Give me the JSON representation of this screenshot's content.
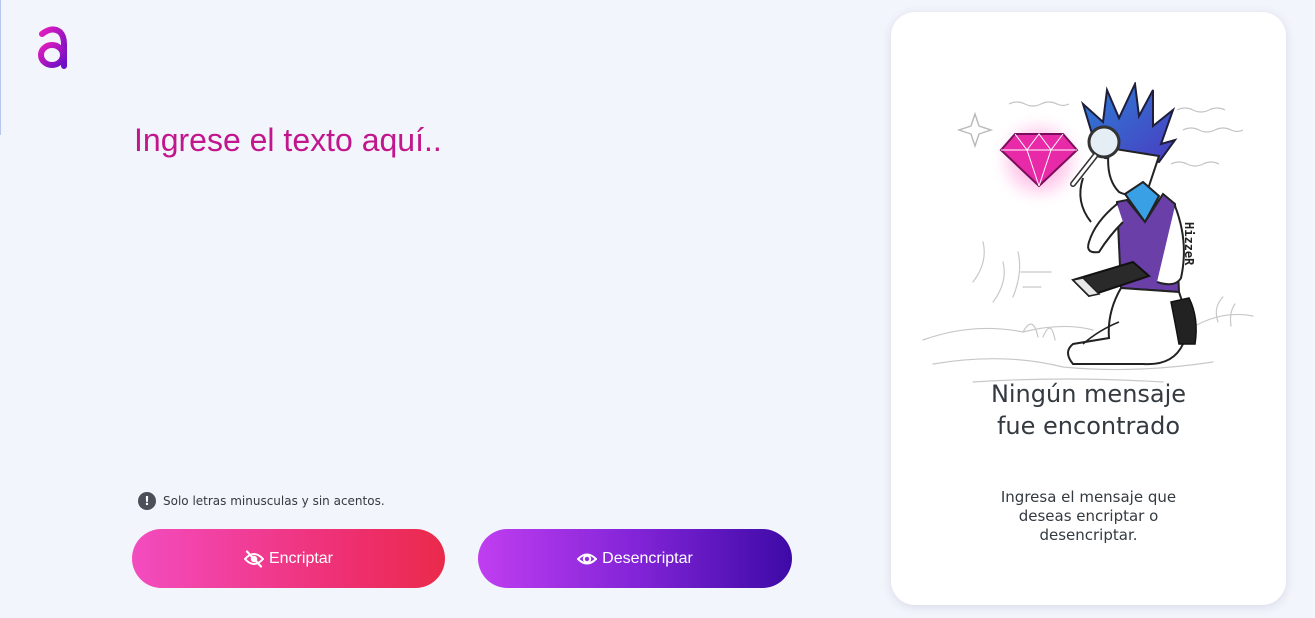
{
  "input": {
    "placeholder": "Ingrese el texto aquí..",
    "value": ""
  },
  "hint": {
    "icon": "exclamation-circle-icon",
    "text": "Solo letras minusculas y sin acentos."
  },
  "buttons": {
    "encrypt_label": "Encriptar",
    "encrypt_icon": "eye-slash-icon",
    "decrypt_label": "Desencriptar",
    "decrypt_icon": "eye-icon"
  },
  "output_panel": {
    "title": "Ningún mensaje fue encontrado",
    "text": "Ingresa el mensaje que deseas encriptar o desencriptar.",
    "illustration_signature": "HizzeR"
  },
  "colors": {
    "background": "#f3f5fc",
    "placeholder": "#c2168d",
    "encrypt_start": "#f34cc0",
    "encrypt_end": "#ea2a4a",
    "decrypt_start": "#c03ef0",
    "decrypt_end": "#3d0aa6"
  }
}
